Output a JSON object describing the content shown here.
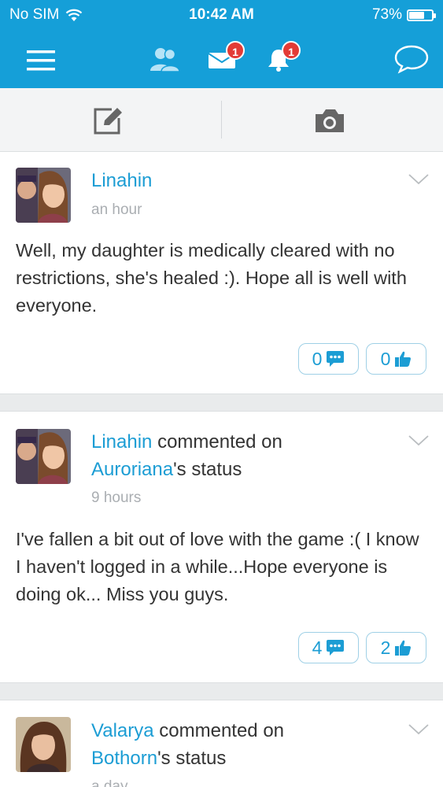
{
  "status_bar": {
    "carrier": "No SIM",
    "time": "10:42 AM",
    "battery": "73%",
    "battery_level": 0.73
  },
  "nav": {
    "messages_badge": "1",
    "notifications_badge": "1"
  },
  "colors": {
    "brand": "#159fd8",
    "link": "#1c9dd4",
    "badge": "#e33b36"
  },
  "posts": [
    {
      "author": "Linahin",
      "action": "",
      "target": "",
      "target_suffix": "",
      "time": "an hour",
      "text": "Well, my daughter is medically cleared with no restrictions, she's healed :). Hope all is well with everyone.",
      "comments": "0",
      "likes": "0"
    },
    {
      "author": "Linahin",
      "action": " commented on",
      "target": "Auroriana",
      "target_suffix": "'s status",
      "time": "9 hours",
      "text": "I've fallen a bit out of love with the game :( I know I haven't logged in a while...Hope everyone is doing ok... Miss you guys.",
      "comments": "4",
      "likes": "2"
    },
    {
      "author": "Valarya",
      "action": " commented on",
      "target": "Bothorn",
      "target_suffix": "'s status",
      "time": "a day"
    }
  ]
}
